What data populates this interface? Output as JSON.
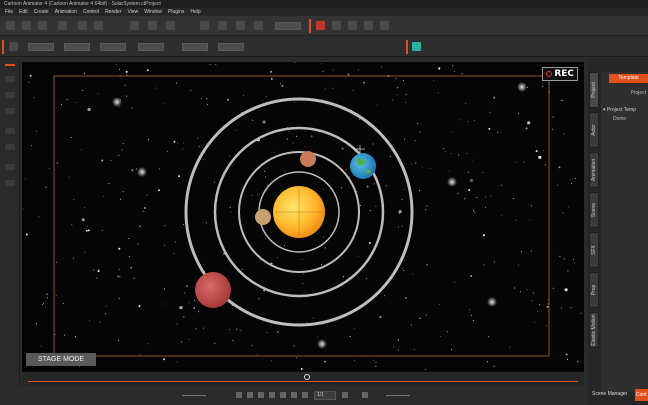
{
  "window": {
    "title": "Cartoon Animator 4 (Cartoon Animator 4 64bit) - SolarSystem.ctProject"
  },
  "menu": [
    "File",
    "Edit",
    "Create",
    "Animation",
    "Control",
    "Render",
    "View",
    "Window",
    "Plugins",
    "Help"
  ],
  "stage": {
    "rec_label": "REC",
    "mode_label": "STAGE MODE"
  },
  "playback": {
    "frame_value": "1/1"
  },
  "right_panel": {
    "tabs": [
      "Project",
      "Actor",
      "Animation",
      "Scene",
      "SFX",
      "Prop",
      "Elastic Motion"
    ],
    "template_button": "Template",
    "project_label": "Project",
    "tree_root": "Project Temp",
    "tree_child": "Demo",
    "scene_manager": "Scene Manager",
    "content_button": "Cont"
  },
  "colors": {
    "accent": "#e0501b",
    "stage_bg": "#050505",
    "orbit": "#b5b5b5",
    "sun_center": "#ffd24a",
    "sun_edge": "#f0901a"
  }
}
